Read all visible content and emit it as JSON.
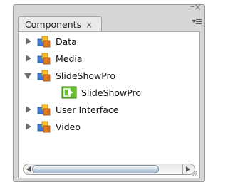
{
  "panel": {
    "tab_label": "Components",
    "tab_close": "×",
    "window_close": "×",
    "window_minimize": "–"
  },
  "tree": {
    "items": [
      {
        "label": "Data",
        "expanded": false,
        "icon": "folder-cubes-icon"
      },
      {
        "label": "Media",
        "expanded": false,
        "icon": "folder-cubes-icon"
      },
      {
        "label": "SlideShowPro",
        "expanded": true,
        "icon": "folder-cubes-icon"
      },
      {
        "label": "SlideShowPro",
        "child": true,
        "icon": "component-icon"
      },
      {
        "label": "User Interface",
        "expanded": false,
        "icon": "folder-cubes-icon"
      },
      {
        "label": "Video",
        "expanded": false,
        "icon": "folder-cubes-icon"
      }
    ]
  },
  "colors": {
    "panel_bg": "#d6d6d6",
    "content_bg": "#ffffff",
    "scroll_thumb": "#c4d2e2",
    "component_green": "#6abf2e"
  }
}
